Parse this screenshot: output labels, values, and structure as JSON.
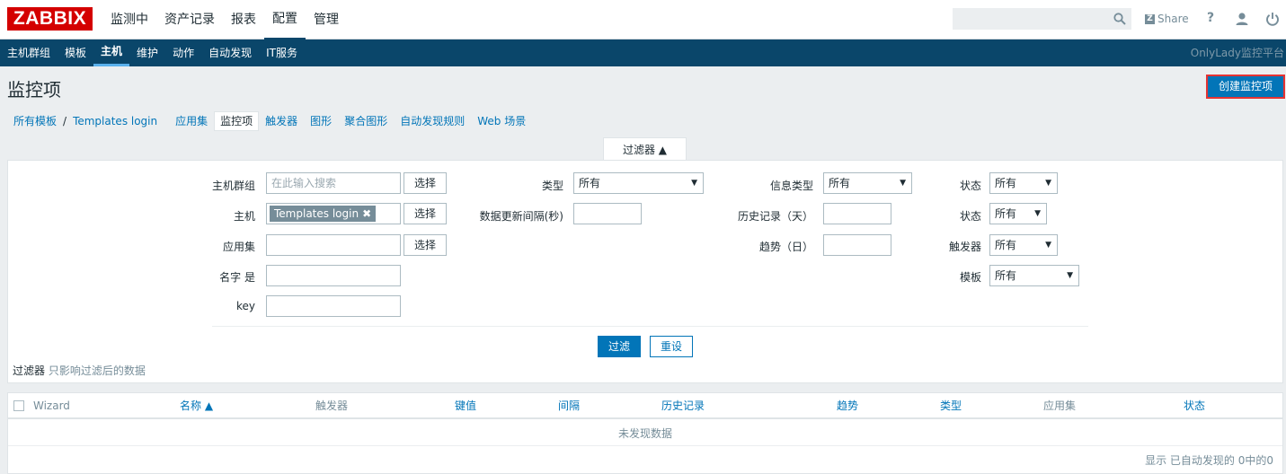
{
  "logo": "ZABBIX",
  "topnav": [
    {
      "label": "监测中",
      "active": false
    },
    {
      "label": "资产记录",
      "active": false
    },
    {
      "label": "报表",
      "active": false
    },
    {
      "label": "配置",
      "active": true
    },
    {
      "label": "管理",
      "active": false
    }
  ],
  "header_tools": {
    "share_label": "Share",
    "help_label": "?"
  },
  "subnav": [
    {
      "label": "主机群组",
      "active": false
    },
    {
      "label": "模板",
      "active": false
    },
    {
      "label": "主机",
      "active": true
    },
    {
      "label": "维护",
      "active": false
    },
    {
      "label": "动作",
      "active": false
    },
    {
      "label": "自动发现",
      "active": false
    },
    {
      "label": "IT服务",
      "active": false
    }
  ],
  "platform_name": "OnlyLady监控平台",
  "page_title": "监控项",
  "create_button": "创建监控项",
  "breadcrumbs": {
    "all_templates": "所有模板",
    "separator": "/",
    "template": "Templates login",
    "tabs": [
      "应用集",
      "监控项",
      "触发器",
      "图形",
      "聚合图形",
      "自动发现规则",
      "Web 场景"
    ],
    "selected": "监控项"
  },
  "filter": {
    "tab_label": "过滤器 ▲",
    "host_group_label": "主机群组",
    "host_group_placeholder": "在此输入搜索",
    "select_label": "选择",
    "host_label": "主机",
    "host_tag": "Templates login",
    "host_tag_remove": "✖",
    "app_label": "应用集",
    "name_label": "名字 是",
    "key_label": "key",
    "type_label": "类型",
    "type_value": "所有",
    "interval_label": "数据更新间隔(秒)",
    "info_type_label": "信息类型",
    "info_type_value": "所有",
    "history_label": "历史记录（天）",
    "trends_label": "趋势（日）",
    "status_label": "状态",
    "status_value": "所有",
    "state_label": "状态",
    "state_value": "所有",
    "triggers_label": "触发器",
    "triggers_value": "所有",
    "template_label": "模板",
    "template_value": "所有",
    "apply_button": "过滤",
    "reset_button": "重设",
    "note_title": "过滤器",
    "note_text": "只影响过滤后的数据"
  },
  "table": {
    "columns": [
      "Wizard",
      "名称 ▲",
      "触发器",
      "键值",
      "间隔",
      "历史记录",
      "趋势",
      "类型",
      "应用集",
      "状态"
    ],
    "empty_text": "未发现数据",
    "footer": "显示 已自动发现的 0中的0"
  }
}
